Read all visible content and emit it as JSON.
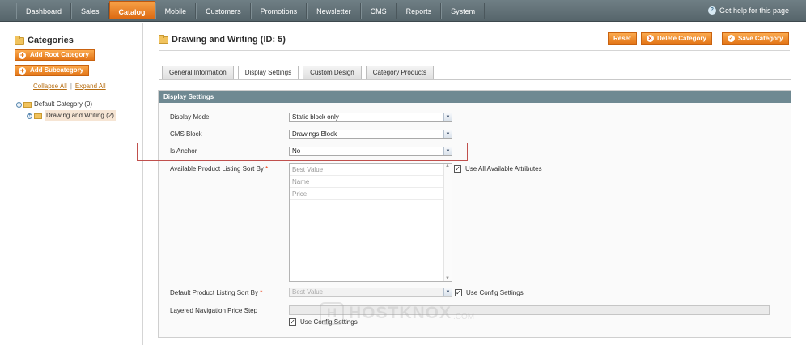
{
  "nav": {
    "items": [
      "Dashboard",
      "Sales",
      "Catalog",
      "Mobile",
      "Customers",
      "Promotions",
      "Newsletter",
      "CMS",
      "Reports",
      "System"
    ],
    "active": "Catalog",
    "help": "Get help for this page"
  },
  "sidebar": {
    "title": "Categories",
    "add_root": "Add Root Category",
    "add_sub": "Add Subcategory",
    "collapse_all": "Collapse All",
    "expand_all": "Expand All",
    "separator": "|",
    "tree": [
      {
        "label": "Default Category (0)",
        "toggle": "−"
      },
      {
        "label": "Drawing and Writing (2)",
        "toggle": "+"
      }
    ]
  },
  "main": {
    "title": "Drawing and Writing (ID: 5)",
    "reset": "Reset",
    "delete": "Delete Category",
    "save": "Save Category",
    "tabs": [
      "General Information",
      "Display Settings",
      "Custom Design",
      "Category Products"
    ],
    "section_title": "Display Settings"
  },
  "form": {
    "display_mode_label": "Display Mode",
    "display_mode_value": "Static block only",
    "cms_block_label": "CMS Block",
    "cms_block_value": "Drawings Block",
    "is_anchor_label": "Is Anchor",
    "is_anchor_value": "No",
    "sort_by_label": "Available Product Listing Sort By",
    "sort_options": [
      "Best Value",
      "Name",
      "Price"
    ],
    "use_all_attributes": "Use All Available Attributes",
    "default_sort_label": "Default Product Listing Sort By",
    "default_sort_value": "Best Value",
    "use_config_1": "Use Config Settings",
    "price_step_label": "Layered Navigation Price Step",
    "use_config_2": "Use Config Settings",
    "required_mark": "*"
  },
  "watermark": {
    "logo": "H",
    "text": "HOSTKNOX",
    "suffix": ".COM"
  },
  "colors": {
    "accent": "#e37618",
    "nav_bg": "#5f6e74",
    "section_head": "#6f8992",
    "highlight": "#c0504d"
  }
}
